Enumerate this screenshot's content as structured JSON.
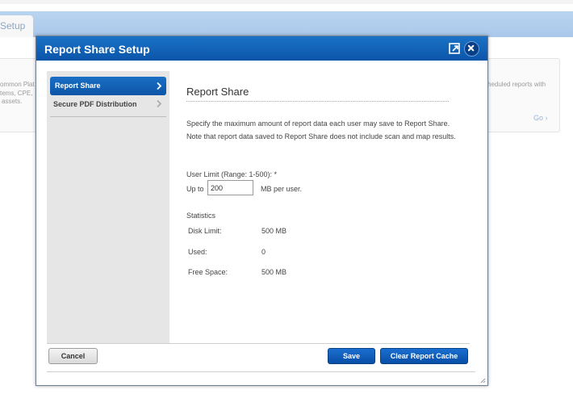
{
  "background": {
    "tab_label": "Setup",
    "left_card_lines": [
      "ommon Plat",
      "tems, CPE,",
      "assets."
    ],
    "right_card_text": "heduled reports with",
    "go_link": "Go"
  },
  "modal": {
    "title": "Report Share Setup",
    "popout_icon": "popout-icon",
    "close_icon": "close-icon"
  },
  "sidebar": {
    "items": [
      {
        "label": "Report Share",
        "active": true
      },
      {
        "label": "Secure PDF Distribution",
        "active": false
      }
    ]
  },
  "content": {
    "title": "Report Share",
    "description": "Specify the maximum amount of report data each user may save to Report Share. Note that report data saved to Report Share does not include scan and map results.",
    "user_limit_label": "User Limit (Range: 1-500): *",
    "up_to": "Up to",
    "user_limit_value": "200",
    "mb_per_user": "MB per user.",
    "statistics_heading": "Statistics",
    "stats": [
      {
        "label": "Disk Limit:",
        "value": "500 MB"
      },
      {
        "label": "Used:",
        "value": "0"
      },
      {
        "label": "Free Space:",
        "value": "500 MB"
      }
    ]
  },
  "footer": {
    "cancel_label": "Cancel",
    "save_label": "Save",
    "clear_cache_label": "Clear Report Cache"
  },
  "colors": {
    "header_blue": "#0b55a9",
    "button_blue": "#0a4fa6",
    "sidebar_gray": "#e6e6e6"
  }
}
